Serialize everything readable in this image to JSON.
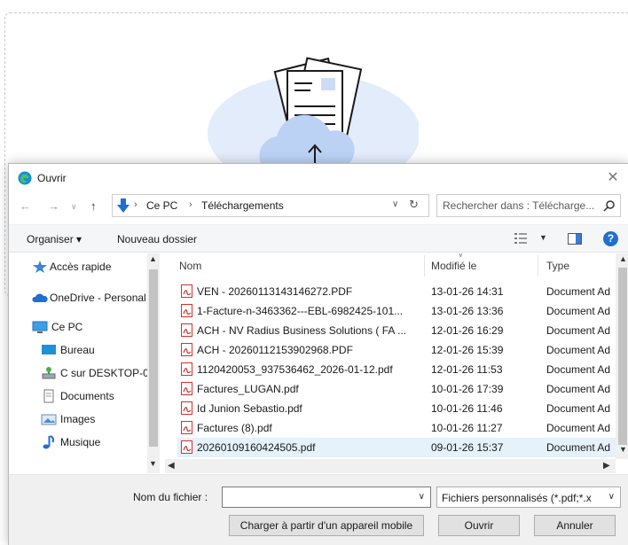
{
  "dialog": {
    "title": "Ouvrir",
    "close_glyph": "✕"
  },
  "address": {
    "path": [
      "Ce PC",
      "Téléchargements"
    ],
    "separator": "›"
  },
  "search": {
    "placeholder": "Rechercher dans : Télécharge..."
  },
  "toolbar": {
    "organize": "Organiser ▾",
    "new_folder": "Nouveau dossier",
    "help": "?"
  },
  "nav": {
    "items": [
      {
        "label": "Accès rapide",
        "icon": "star-icon"
      },
      {
        "label": "OneDrive - Personal",
        "icon": "cloud-icon"
      },
      {
        "label": "Ce PC",
        "icon": "computer-icon"
      },
      {
        "label": "Bureau",
        "icon": "desktop-icon"
      },
      {
        "label": "C sur DESKTOP-0",
        "icon": "network-drive-icon"
      },
      {
        "label": "Documents",
        "icon": "documents-icon"
      },
      {
        "label": "Images",
        "icon": "images-icon"
      },
      {
        "label": "Musique",
        "icon": "music-icon"
      }
    ]
  },
  "columns": {
    "name": "Nom",
    "modified": "Modifié le",
    "type": "Type"
  },
  "files": [
    {
      "name": "VEN - 20260113143146272.PDF",
      "date": "13-01-26 14:31",
      "type": "Document Ad"
    },
    {
      "name": "1-Facture-n-3463362---EBL-6982425-101...",
      "date": "13-01-26 13:36",
      "type": "Document Ad"
    },
    {
      "name": "ACH - NV Radius Business Solutions ( FA ...",
      "date": "12-01-26 16:29",
      "type": "Document Ad"
    },
    {
      "name": "ACH - 20260112153902968.PDF",
      "date": "12-01-26 15:39",
      "type": "Document Ad"
    },
    {
      "name": "1120420053_937536462_2026-01-12.pdf",
      "date": "12-01-26 11:53",
      "type": "Document Ad"
    },
    {
      "name": "Factures_LUGAN.pdf",
      "date": "10-01-26 17:39",
      "type": "Document Ad"
    },
    {
      "name": "Id Junion Sebastio.pdf",
      "date": "10-01-26 11:46",
      "type": "Document Ad"
    },
    {
      "name": "Factures (8).pdf",
      "date": "10-01-26 11:27",
      "type": "Document Ad"
    },
    {
      "name": "20260109160424505.pdf",
      "date": "09-01-26 15:37",
      "type": "Document Ad"
    }
  ],
  "footer": {
    "filename_label": "Nom du fichier :",
    "filename_value": "",
    "filter": "Fichiers personnalisés (*.pdf;*.x",
    "mobile_button": "Charger à partir d'un appareil mobile",
    "open_button": "Ouvrir",
    "cancel_button": "Annuler"
  },
  "colors": {
    "accent": "#1f6fd1",
    "pdf_red": "#d0312d",
    "selected_row": "#e5f1fb"
  }
}
